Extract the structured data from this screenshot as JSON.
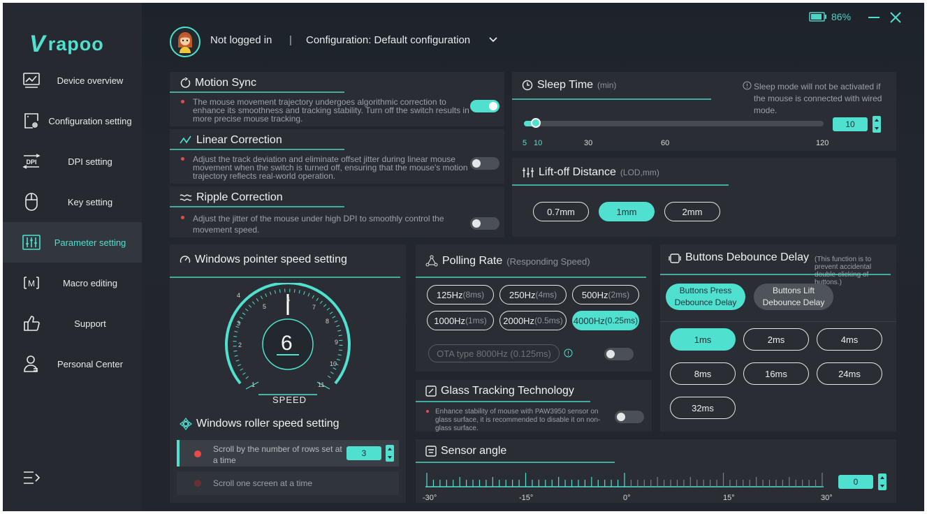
{
  "sidebar": {
    "logo_text": "rapoo",
    "items": [
      {
        "label": "Device overview",
        "icon": "chart-monitor-icon"
      },
      {
        "label": "Configuration setting",
        "icon": "config-gear-icon"
      },
      {
        "label": "DPI setting",
        "icon": "dpi-icon"
      },
      {
        "label": "Key setting",
        "icon": "mouse-icon"
      },
      {
        "label": "Parameter setting",
        "icon": "sliders-icon",
        "active": true
      },
      {
        "label": "Macro editing",
        "icon": "macro-icon"
      },
      {
        "label": "Support",
        "icon": "thumbs-up-icon"
      },
      {
        "label": "Personal Center",
        "icon": "user-icon"
      }
    ]
  },
  "header": {
    "login_status": "Not logged in",
    "separator": "|",
    "configuration": "Configuration: Default configuration",
    "battery_percent": "86%"
  },
  "motion_sync": {
    "title": "Motion Sync",
    "description": "The mouse movement trajectory undergoes algorithmic correction to enhance its smoothness and tracking stability. Turn off the switch results in more precise mouse tracking.",
    "enabled": true
  },
  "linear_correction": {
    "title": "Linear Correction",
    "description": "Adjust the track deviation and eliminate offset jitter during linear mouse movement when the switch is turned off, ensuring that the mouse's motion trajectory reflects real-world operation.",
    "enabled": false
  },
  "ripple_correction": {
    "title": "Ripple Correction",
    "description": "Adjust the jitter of the mouse under high DPI to smoothly control the movement speed.",
    "enabled": false
  },
  "sleep_time": {
    "title": "Sleep Time",
    "unit": "(min)",
    "note": "Sleep mode will not be activated if the mouse is connected with wired mode.",
    "value": "10",
    "ticks": [
      "5",
      "10",
      "30",
      "60",
      "120"
    ]
  },
  "lift_off": {
    "title": "Lift-off Distance",
    "unit": "(LOD,mm)",
    "options": [
      "0.7mm",
      "1mm",
      "2mm"
    ],
    "selected": "1mm"
  },
  "pointer_speed": {
    "title": "Windows pointer speed setting",
    "value": "6",
    "label": "SPEED",
    "dial_marks": [
      "1",
      "2",
      "3",
      "4",
      "5",
      "6",
      "7",
      "8",
      "9",
      "10",
      "11"
    ]
  },
  "roller_speed": {
    "title": "Windows roller speed setting",
    "option_rows": "Scroll by the number of rows set at a time",
    "rows_value": "3",
    "option_screen": "Scroll one screen at a time"
  },
  "polling_rate": {
    "title": "Polling Rate",
    "subtitle": "(Responding Speed)",
    "options": [
      {
        "hz": "125Hz",
        "ms": "(8ms)"
      },
      {
        "hz": "250Hz",
        "ms": "(4ms)"
      },
      {
        "hz": "500Hz",
        "ms": "(2ms)"
      },
      {
        "hz": "1000Hz",
        "ms": "(1ms)"
      },
      {
        "hz": "2000Hz",
        "ms": "(0.5ms)"
      },
      {
        "hz": "4000Hz",
        "ms": "(0.25ms)"
      }
    ],
    "selected": "4000Hz",
    "ota_label": "OTA type 8000Hz (0.125ms)"
  },
  "glass_tracking": {
    "title": "Glass Tracking Technology",
    "description": "Enhance stability of mouse with PAW3950 sensor on glass surface, it is recommended to disable it on non-glass surface.",
    "enabled": false
  },
  "debounce": {
    "title": "Buttons Debounce Delay",
    "note": "(This function is to prevent accidental double-clicking of buttons.)",
    "tab_press": "Buttons Press Debounce Delay",
    "tab_lift": "Buttons Lift Debounce Delay",
    "options": [
      "1ms",
      "2ms",
      "4ms",
      "8ms",
      "16ms",
      "24ms",
      "32ms"
    ],
    "selected": "1ms"
  },
  "sensor_angle": {
    "title": "Sensor angle",
    "value": "0",
    "ticks": [
      "-30°",
      "-15°",
      "0°",
      "15°",
      "30°"
    ]
  },
  "colors": {
    "accent": "#4fe0cf",
    "panel": "#2a2e34",
    "sidebar": "#262a30",
    "alert": "#e84a4a"
  }
}
